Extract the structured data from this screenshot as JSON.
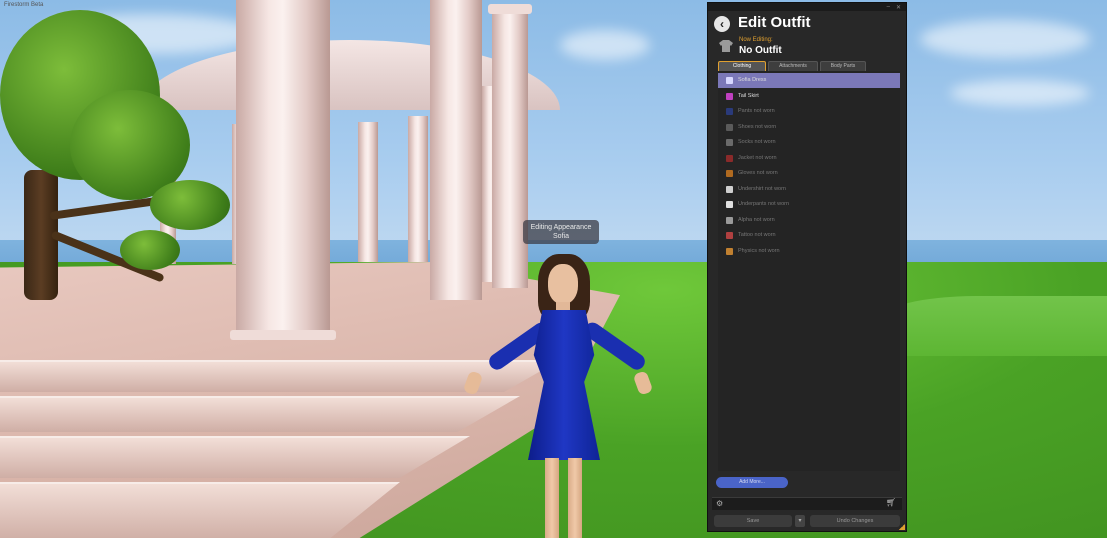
{
  "scene": {
    "window_caption": "Firestorm Beta",
    "name_tag": "Editing Appearance\nSofia"
  },
  "panel": {
    "title": "Edit Outfit",
    "now_editing_label": "Now Editing:",
    "outfit_name": "No Outfit",
    "tabs": [
      {
        "label": "Clothing",
        "active": true
      },
      {
        "label": "Attachments",
        "active": false
      },
      {
        "label": "Body Parts",
        "active": false
      }
    ],
    "items": [
      {
        "label": "Sofia Dress",
        "icon": "shirt-icon",
        "color": "#d8d8ff",
        "worn": true,
        "selected": true
      },
      {
        "label": "Tail Skirt",
        "icon": "skirt-icon",
        "color": "#c040c0",
        "worn": true,
        "selected": false
      },
      {
        "label": "Pants not worn",
        "icon": "pants-icon",
        "color": "#2a3a7a",
        "worn": false,
        "selected": false
      },
      {
        "label": "Shoes not worn",
        "icon": "shoe-icon",
        "color": "#5a5a5a",
        "worn": false,
        "selected": false
      },
      {
        "label": "Socks not worn",
        "icon": "sock-icon",
        "color": "#6a6a6a",
        "worn": false,
        "selected": false
      },
      {
        "label": "Jacket not worn",
        "icon": "jacket-icon",
        "color": "#8a2a2a",
        "worn": false,
        "selected": false
      },
      {
        "label": "Gloves not worn",
        "icon": "glove-icon",
        "color": "#b06a20",
        "worn": false,
        "selected": false
      },
      {
        "label": "Undershirt not worn",
        "icon": "undershirt-icon",
        "color": "#cfcfcf",
        "worn": false,
        "selected": false
      },
      {
        "label": "Underpants not worn",
        "icon": "underpants-icon",
        "color": "#e0e0e0",
        "worn": false,
        "selected": false
      },
      {
        "label": "Alpha not worn",
        "icon": "alpha-icon",
        "color": "#9a9a9a",
        "worn": false,
        "selected": false
      },
      {
        "label": "Tattoo not worn",
        "icon": "tattoo-icon",
        "color": "#b04040",
        "worn": false,
        "selected": false
      },
      {
        "label": "Physics not worn",
        "icon": "physics-icon",
        "color": "#c08030",
        "worn": false,
        "selected": false
      }
    ],
    "add_more_label": "Add More...",
    "save_label": "Save",
    "undo_label": "Undo Changes",
    "colors": {
      "accent": "#e0a030",
      "selection": "#7b78b8",
      "background": "#282828"
    }
  }
}
